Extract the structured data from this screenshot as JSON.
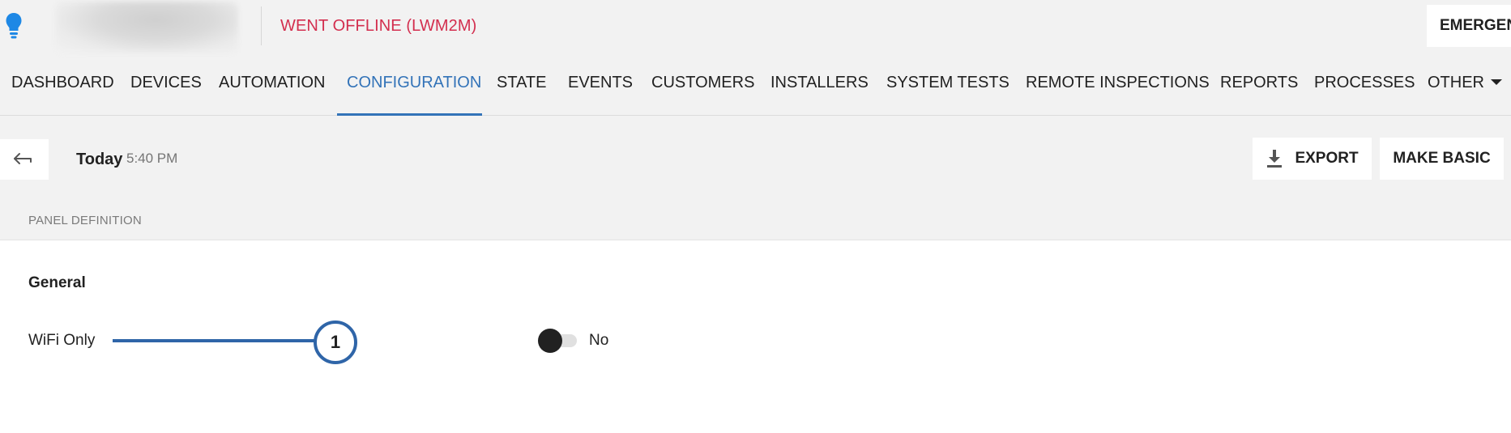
{
  "header": {
    "status_text": "WENT OFFLINE (LWM2M)",
    "emergency_label": "EMERGENCY"
  },
  "nav": {
    "tabs": [
      {
        "label": "DASHBOARD",
        "active": false
      },
      {
        "label": "DEVICES",
        "active": false
      },
      {
        "label": "AUTOMATION",
        "active": false
      },
      {
        "label": "CONFIGURATION",
        "active": true
      },
      {
        "label": "STATE",
        "active": false
      },
      {
        "label": "EVENTS",
        "active": false
      },
      {
        "label": "CUSTOMERS",
        "active": false
      },
      {
        "label": "INSTALLERS",
        "active": false
      },
      {
        "label": "SYSTEM TESTS",
        "active": false
      },
      {
        "label": "REMOTE INSPECTIONS",
        "active": false
      },
      {
        "label": "REPORTS",
        "active": false
      },
      {
        "label": "PROCESSES",
        "active": false
      },
      {
        "label": "OTHER",
        "active": false
      }
    ]
  },
  "toolbar": {
    "date_label": "Today",
    "time_label": "5:40 PM",
    "export_label": "EXPORT",
    "make_basic_label": "MAKE BASIC"
  },
  "section": {
    "label": "PANEL DEFINITION"
  },
  "card": {
    "title": "General",
    "field_label": "WiFi Only",
    "callout_number": "1",
    "toggle_value": "No"
  },
  "colors": {
    "accent": "#3373b8",
    "status_red": "#d32f4f",
    "bulb_blue": "#1e88e5",
    "callout_blue": "#2f65a8"
  },
  "icons": {
    "logo": "lightbulb-icon",
    "back": "back-arrow-icon",
    "export": "download-icon",
    "other_menu": "caret-down-icon"
  }
}
